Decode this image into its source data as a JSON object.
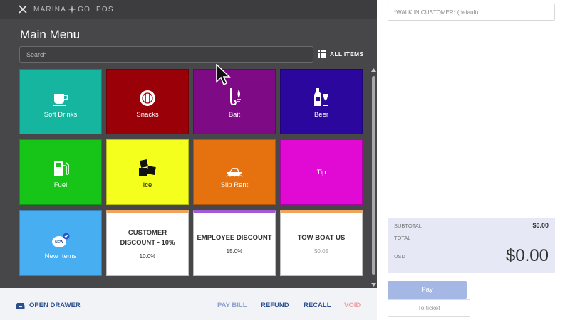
{
  "app": {
    "brand_left": "MARINA",
    "brand_right": "GO  POS"
  },
  "menu": {
    "title": "Main Menu",
    "search_placeholder": "Search",
    "all_items_label": "ALL ITEMS"
  },
  "tiles": [
    {
      "label": "Soft Drinks",
      "color": "#15b5a0",
      "icon": "cup-icon"
    },
    {
      "label": "Snacks",
      "color": "#9a0008",
      "icon": "plate-icon"
    },
    {
      "label": "Bait",
      "color": "#7e0a86",
      "icon": "fishing-bait-icon"
    },
    {
      "label": "Beer",
      "color": "#2b079d",
      "icon": "beer-bottle-icon"
    },
    {
      "label": "Fuel",
      "color": "#16c518",
      "icon": "fuel-pump-icon"
    },
    {
      "label": "Ice",
      "color": "#f4ff1d",
      "icon": "ice-cubes-icon"
    },
    {
      "label": "Slip Rent",
      "color": "#e6720f",
      "icon": "boat-icon"
    },
    {
      "label": "Tip",
      "color": "#e00ad4",
      "icon": ""
    },
    {
      "label": "New Items",
      "color": "#47aef2",
      "icon": "new-badge-icon"
    },
    {
      "label": "CUSTOMER DISCOUNT - 10%",
      "sub": "10.0%",
      "color": "#ffffff",
      "top_border": "#f0a35a"
    },
    {
      "label": "EMPLOYEE DISCOUNT",
      "sub": "15.0%",
      "color": "#ffffff",
      "top_border": "#a35ad6"
    },
    {
      "label": "TOW BOAT US",
      "sub": "$0.05",
      "color": "#ffffff",
      "top_border": "#f0a35a"
    }
  ],
  "bottom_bar": {
    "open_drawer": "OPEN DRAWER",
    "pay_bill": "PAY BILL",
    "refund": "REFUND",
    "recall": "RECALL",
    "void": "VOID",
    "colors": {
      "active": "#2b4f8c",
      "muted": "#8ea3cc",
      "void": "#f2a0a0"
    }
  },
  "customer": {
    "value": "*WALK IN CUSTOMER* (default)"
  },
  "totals": {
    "subtotal_label": "SUBTOTAL",
    "subtotal_value": "$0.00",
    "total_label": "TOTAL",
    "currency": "USD",
    "total_value": "$0.00"
  },
  "actions": {
    "pay": "Pay",
    "to_ticket": "To ticket"
  }
}
